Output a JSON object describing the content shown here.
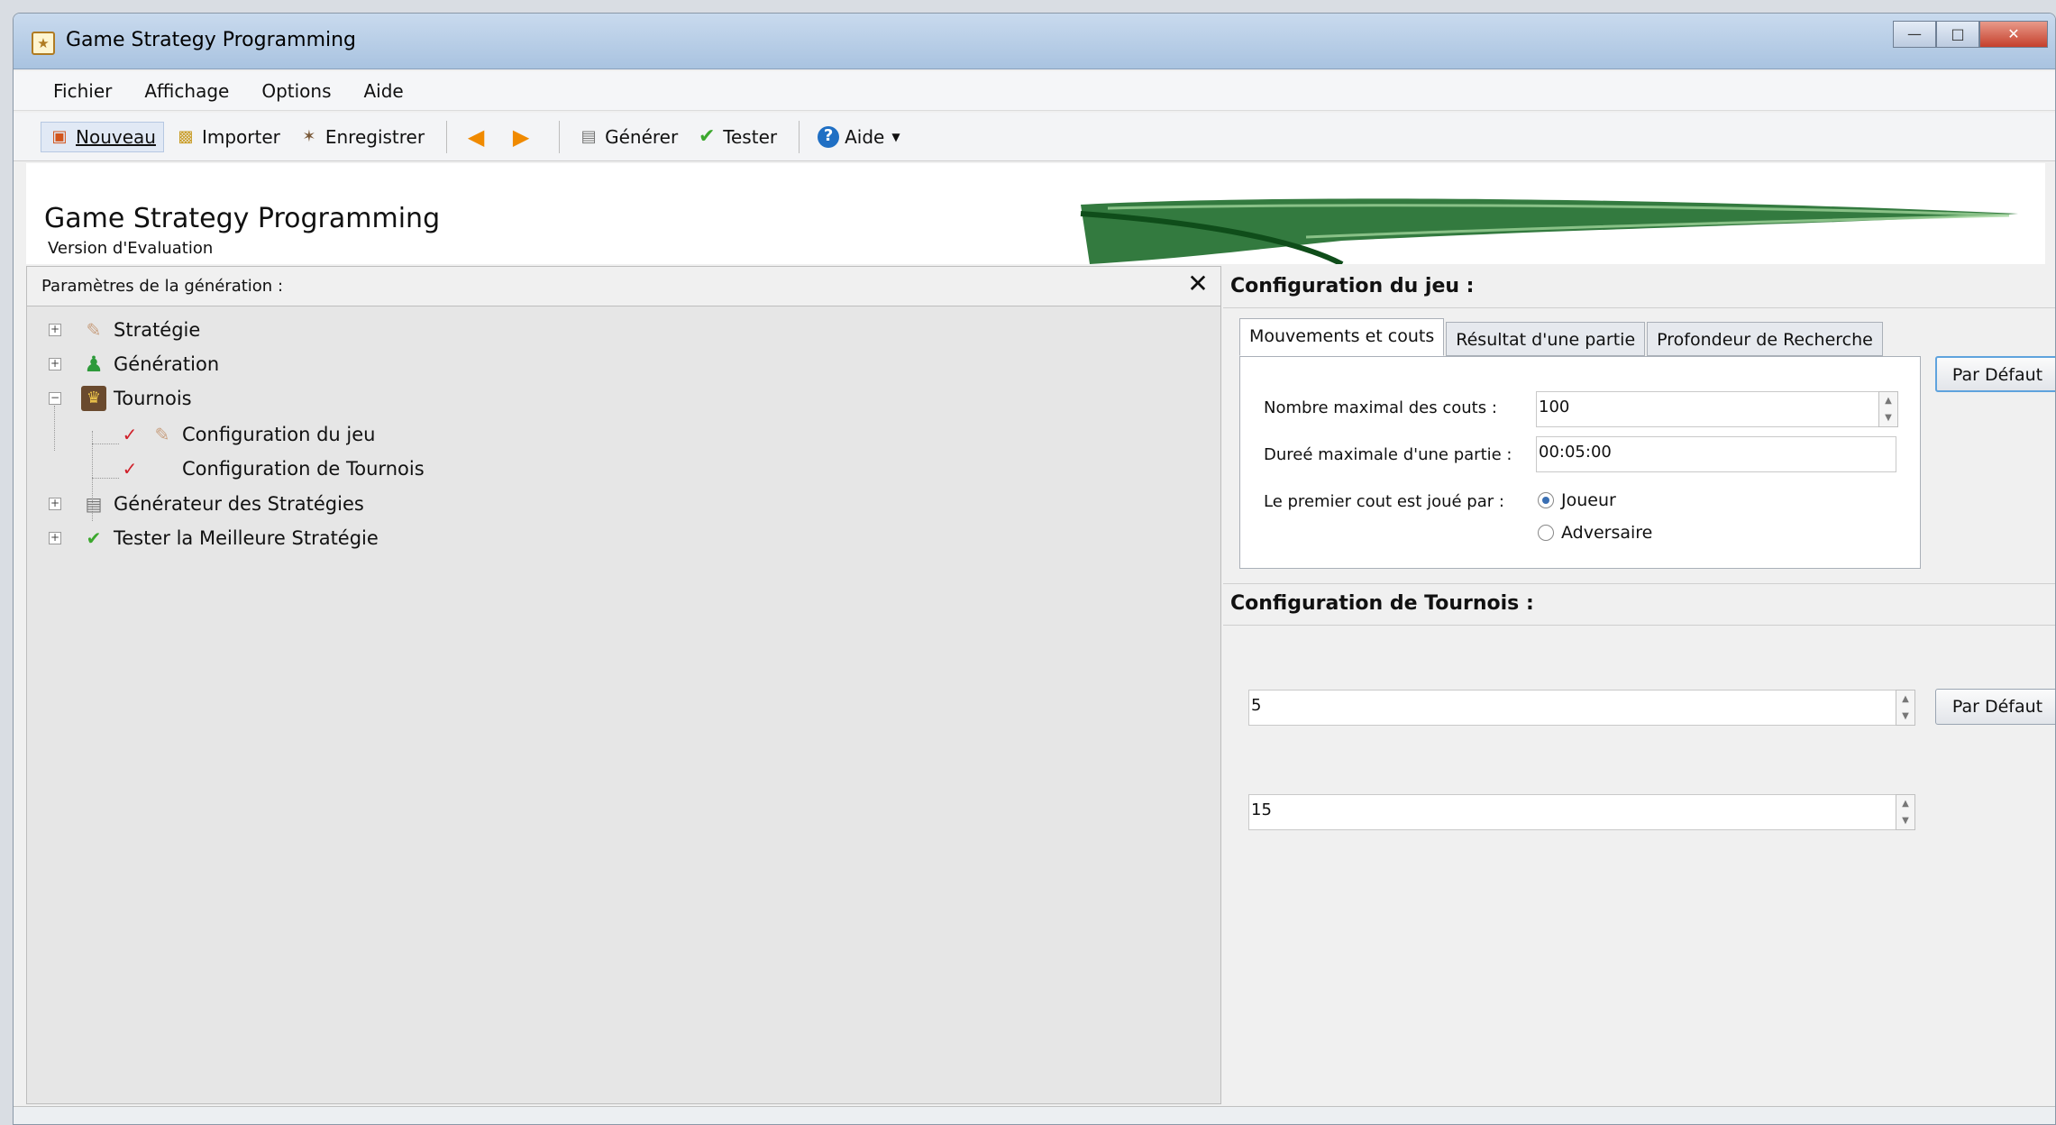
{
  "window": {
    "title": "Game Strategy Programming"
  },
  "menu": [
    "Fichier",
    "Affichage",
    "Options",
    "Aide"
  ],
  "toolbar": {
    "nouveau": "Nouveau",
    "importer": "Importer",
    "enregistrer": "Enregistrer",
    "generer": "Générer",
    "tester": "Tester",
    "aide": "Aide"
  },
  "banner": {
    "title": "Game Strategy Programming",
    "subtitle": "Version d'Evaluation"
  },
  "left": {
    "header": "Paramètres de la génération :",
    "tree": [
      {
        "label": "Stratégie"
      },
      {
        "label": "Génération"
      },
      {
        "label": "Tournois"
      },
      {
        "label": "Configuration du jeu"
      },
      {
        "label": "Configuration de Tournois"
      },
      {
        "label": "Générateur des Stratégies"
      },
      {
        "label": "Tester la Meilleure Stratégie"
      }
    ]
  },
  "game_config": {
    "title": "Configuration du jeu :",
    "tabs": [
      "Mouvements et couts",
      "Résultat d'une partie",
      "Profondeur de Recherche"
    ],
    "default_button": "Par Défaut",
    "max_moves_label": "Nombre maximal des couts :",
    "max_moves_value": "100",
    "max_duration_label": "Dureé maximale d'une partie :",
    "max_duration_value": "00:05:00",
    "first_move_label": "Le premier cout est joué par :",
    "radio_player": "Joueur",
    "radio_opponent": "Adversaire"
  },
  "tournament_config": {
    "title": "Configuration de Tournois :",
    "value1": "5",
    "value2": "15",
    "default_button": "Par Défaut"
  }
}
